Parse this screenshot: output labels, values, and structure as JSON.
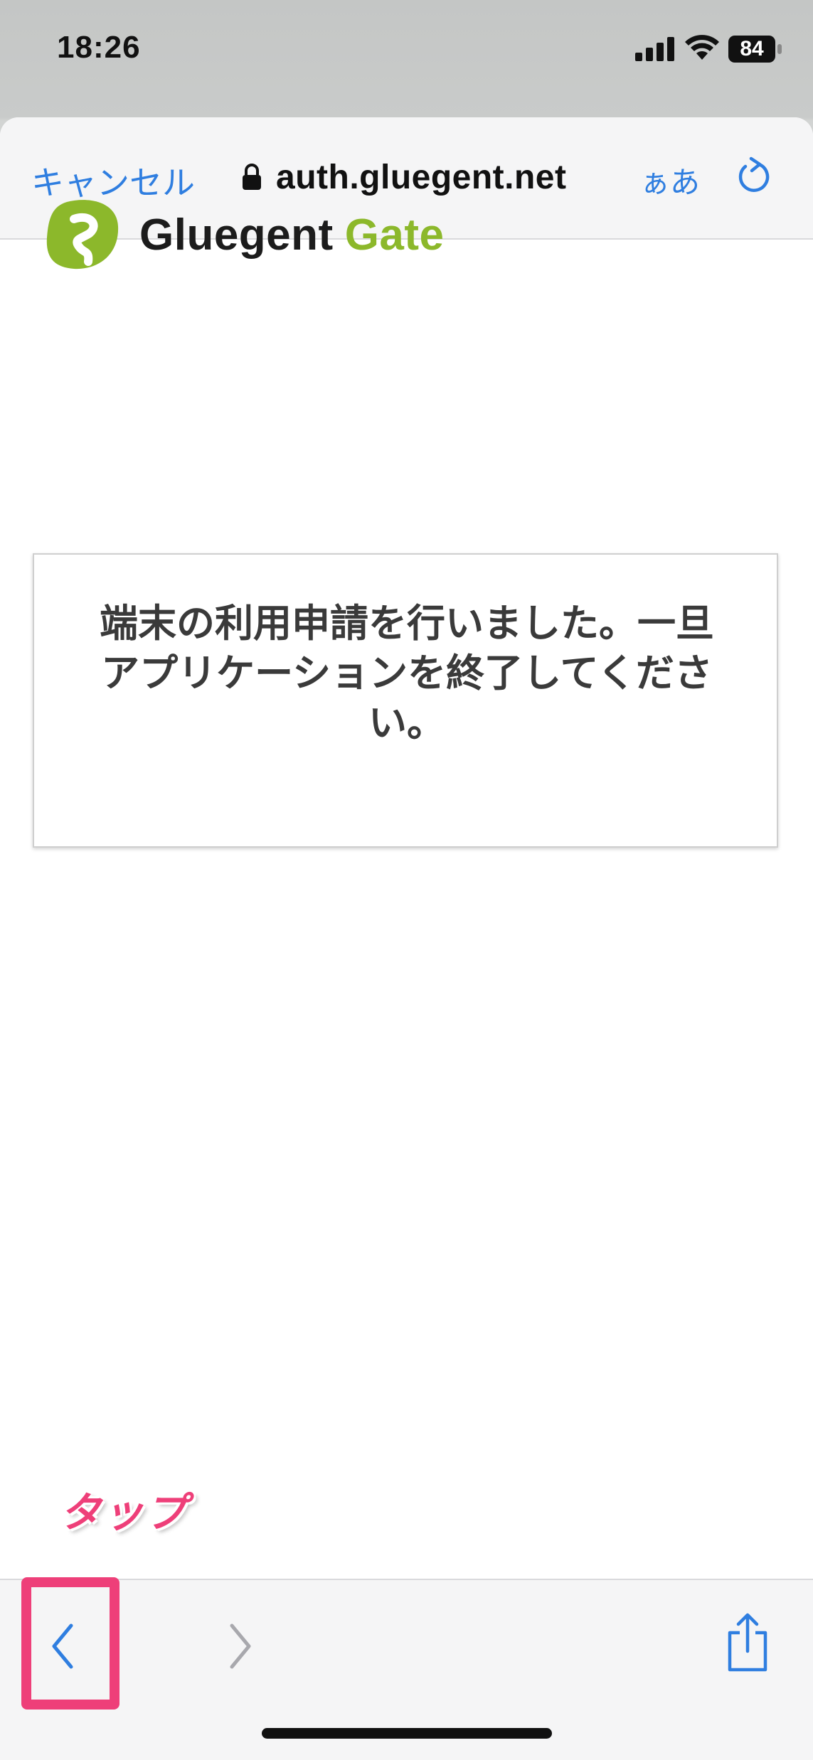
{
  "status_bar": {
    "time": "18:26",
    "battery": "84"
  },
  "nav": {
    "cancel_label": "キャンセル",
    "url": "auth.gluegent.net",
    "text_size_label": "ぁあ"
  },
  "logo": {
    "word1": "Gluegent",
    "word2": "Gate"
  },
  "message": "端末の利用申請を行いました。一旦アプリケーションを終了してください。",
  "annotation": {
    "tap_label": "タップ"
  },
  "colors": {
    "accent": "#2f7ee0",
    "brand_green": "#8cb82b",
    "annotation_pink": "#ee3f79"
  },
  "icons": {
    "lock": "lock-icon",
    "reload": "reload-icon",
    "back": "chevron-left-icon",
    "forward": "chevron-right-icon",
    "share": "share-icon"
  }
}
